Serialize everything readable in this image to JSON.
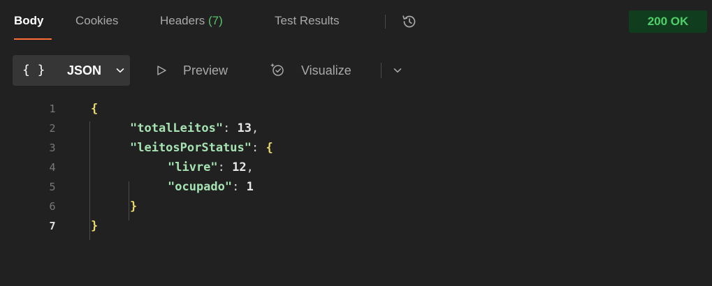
{
  "tabs": [
    {
      "label": "Body",
      "active": true
    },
    {
      "label": "Cookies",
      "active": false
    },
    {
      "label": "Headers",
      "count": "(7)",
      "active": false
    },
    {
      "label": "Test Results",
      "active": false
    }
  ],
  "status": {
    "label": "200 OK",
    "color": "#4fd06a",
    "background": "#0f3d1d"
  },
  "toolbar": {
    "format_braces": "{ }",
    "format_label": "JSON",
    "preview_label": "Preview",
    "visualize_label": "Visualize"
  },
  "icons": {
    "history": "history-clock-icon",
    "format_chevron": "chevron-down-icon",
    "preview": "play-outline-icon",
    "visualize": "visualize-sparkle-icon",
    "visualize_chevron": "chevron-down-icon"
  },
  "accent_color": "#ff6c37",
  "code": {
    "line_numbers": [
      "1",
      "2",
      "3",
      "4",
      "5",
      "6",
      "7"
    ],
    "lines": [
      {
        "open": "{"
      },
      {
        "key": "\"totalLeitos\"",
        "sep": ": ",
        "value": "13",
        "tail": ","
      },
      {
        "key": "\"leitosPorStatus\"",
        "sep": ": ",
        "value": "{",
        "tail": ""
      },
      {
        "key": "\"livre\"",
        "sep": ": ",
        "value": "12",
        "tail": ","
      },
      {
        "key": "\"ocupado\"",
        "sep": ": ",
        "value": "1",
        "tail": ""
      },
      {
        "close": "}"
      },
      {
        "close": "}"
      }
    ]
  }
}
